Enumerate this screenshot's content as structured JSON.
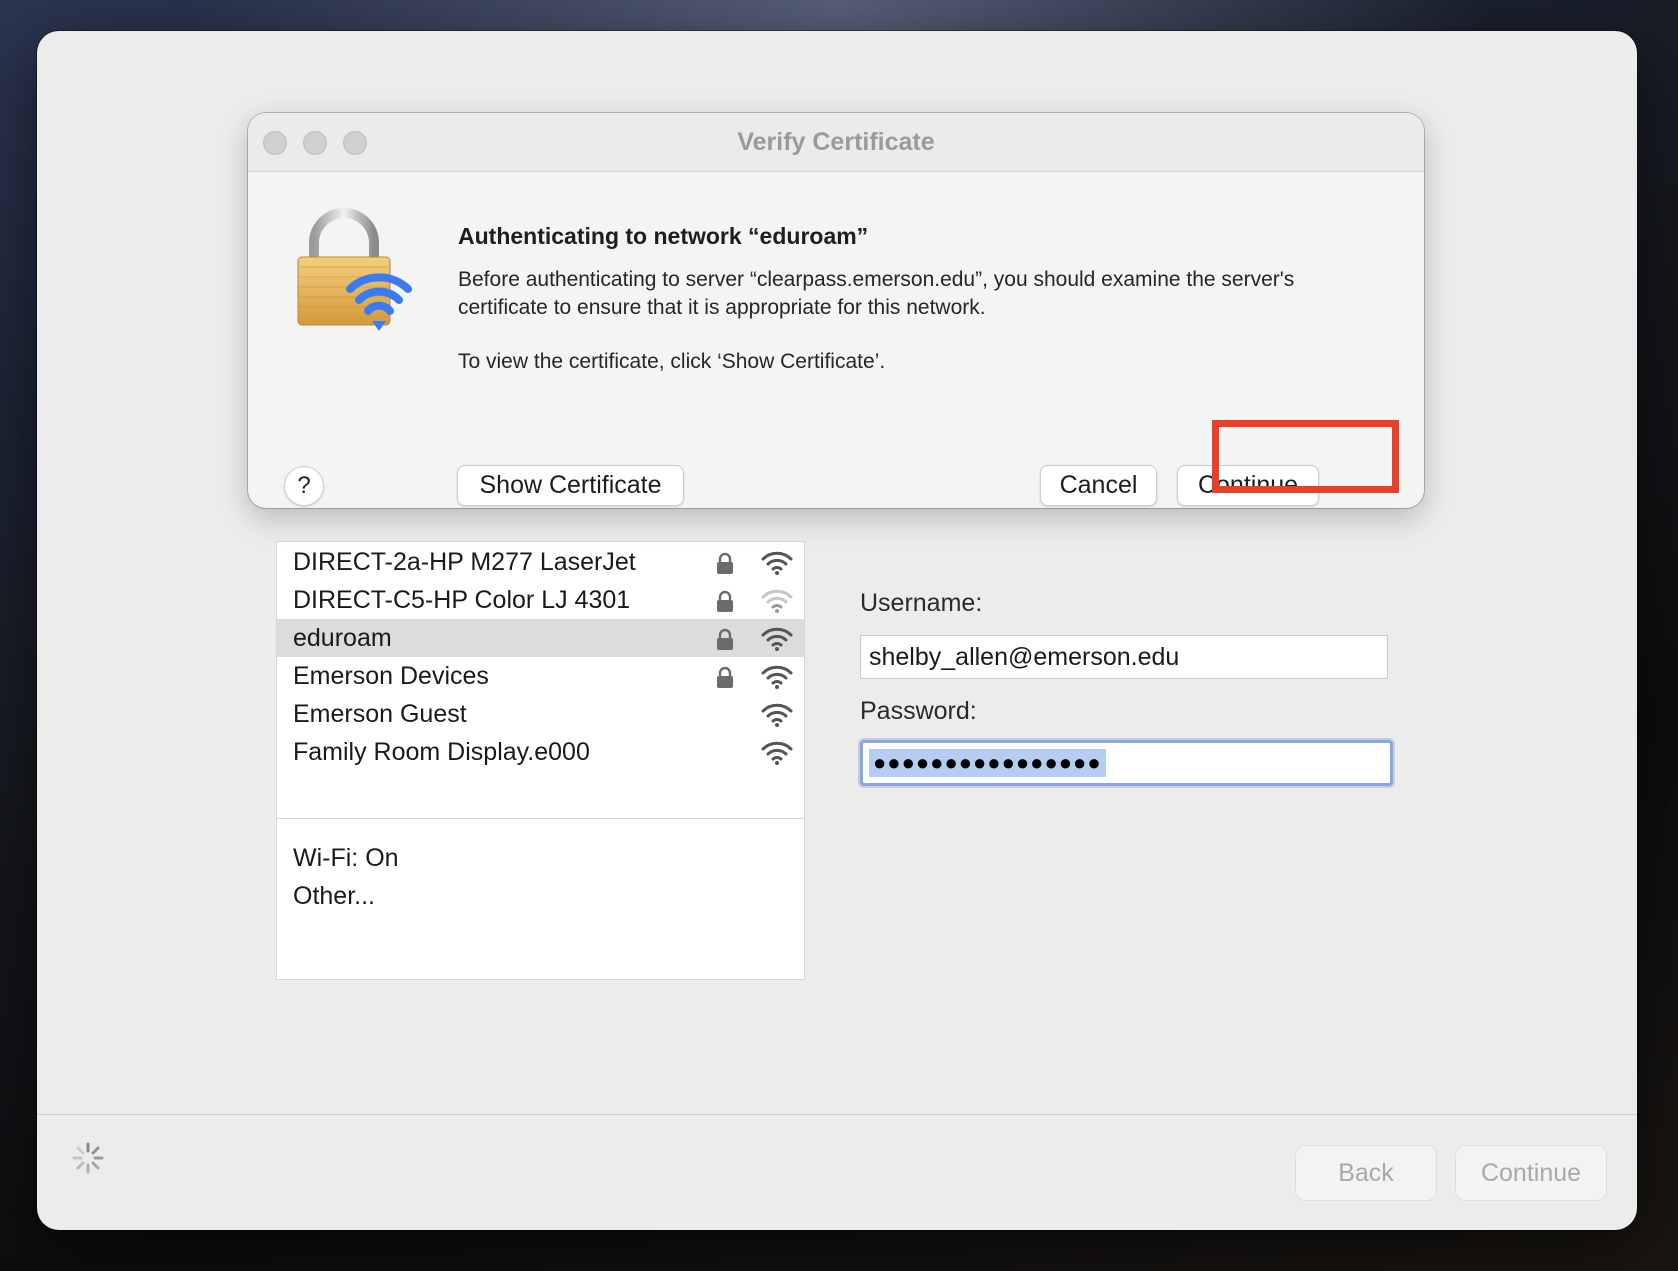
{
  "dialog": {
    "title": "Verify Certificate",
    "heading": "Authenticating to network “eduroam”",
    "body_line": "Before authenticating to server “clearpass.emerson.edu”, you should examine the server's certificate to ensure that it is appropriate for this network.",
    "body_line2": "To view the certificate, click ‘Show Certificate’.",
    "help_label": "?",
    "show_certificate_label": "Show Certificate",
    "cancel_label": "Cancel",
    "continue_label": "Continue",
    "highlight_color": "#e8402a"
  },
  "networks": [
    {
      "name": "DIRECT-2a-HP M277 LaserJet",
      "locked": true,
      "signal": "full"
    },
    {
      "name": "DIRECT-C5-HP Color LJ 4301",
      "locked": true,
      "signal": "weak"
    },
    {
      "name": "eduroam",
      "locked": true,
      "signal": "full",
      "selected": true
    },
    {
      "name": "Emerson Devices",
      "locked": true,
      "signal": "full"
    },
    {
      "name": "Emerson Guest",
      "locked": false,
      "signal": "full"
    },
    {
      "name": "Family Room Display.e000",
      "locked": false,
      "signal": "full"
    }
  ],
  "network_panel": {
    "wifi_status": "Wi-Fi: On",
    "other": "Other..."
  },
  "credentials": {
    "username_label": "Username:",
    "username_value": "shelby_allen@emerson.edu",
    "password_label": "Password:",
    "password_mask": "●●●●●●●●●●●●●●●●"
  },
  "footer": {
    "back_label": "Back",
    "continue_label": "Continue"
  },
  "icons": {
    "lock": "lock-icon",
    "wifi": "wifi-icon",
    "spinner": "spinner-icon",
    "dialog_badge": "lock-wifi-icon"
  }
}
